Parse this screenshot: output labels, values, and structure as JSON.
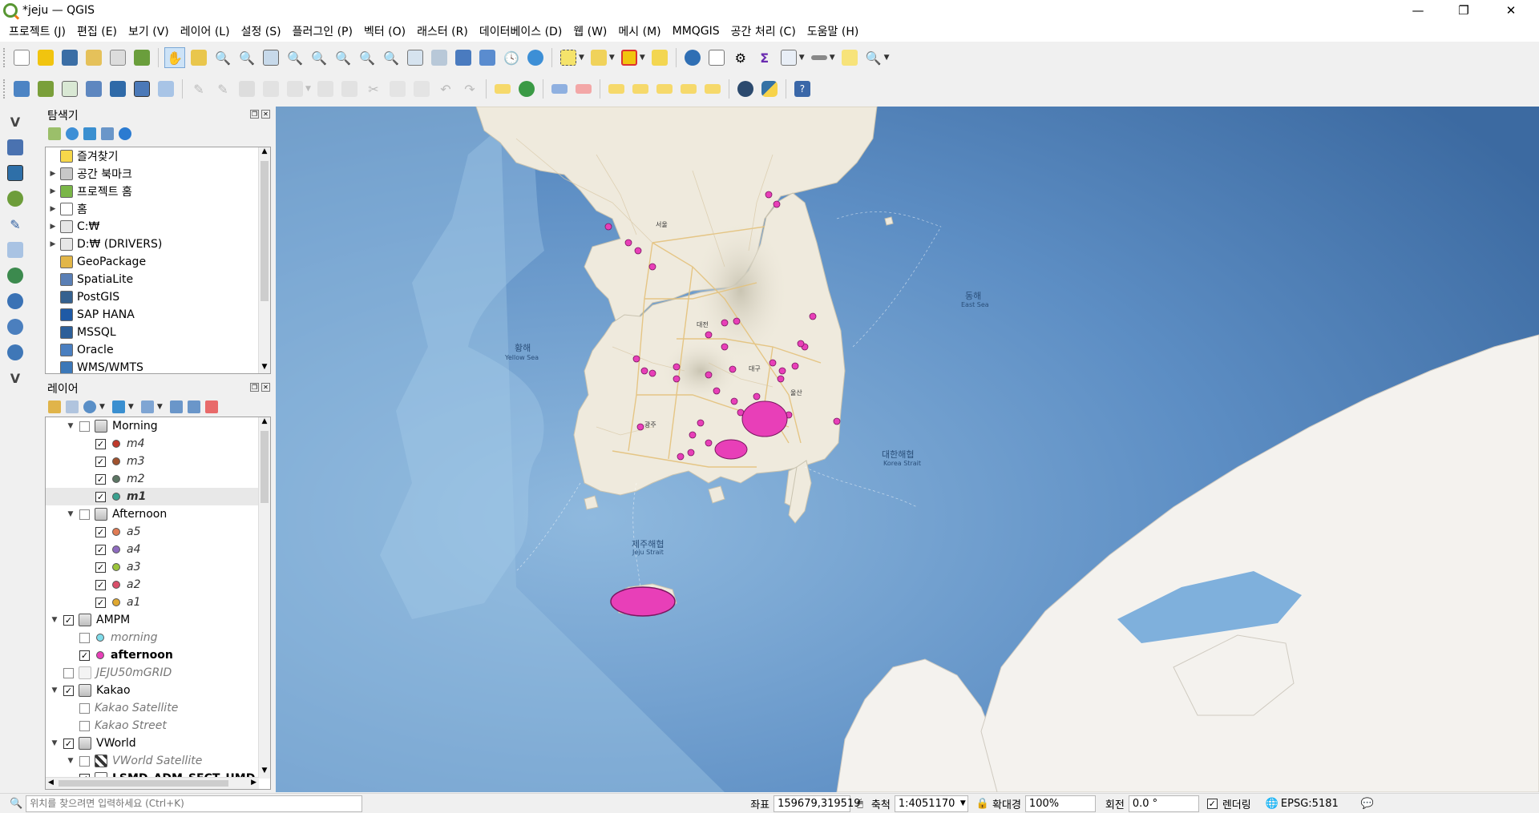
{
  "window": {
    "title": "*jeju — QGIS",
    "minimize": "—",
    "restore": "❐",
    "close": "✕"
  },
  "menu": [
    "프로젝트 (J)",
    "편집 (E)",
    "보기 (V)",
    "레이어 (L)",
    "설정 (S)",
    "플러그인 (P)",
    "벡터 (O)",
    "래스터 (R)",
    "데이터베이스 (D)",
    "웹 (W)",
    "메시 (M)",
    "MMQGIS",
    "공간 처리 (C)",
    "도움말 (H)"
  ],
  "browser": {
    "title": "탐색기",
    "items": [
      {
        "label": "즐겨찾기",
        "icon": "star-icon",
        "expand": false
      },
      {
        "label": "공간 북마크",
        "icon": "bookmark-icon",
        "expand": true
      },
      {
        "label": "프로젝트 홈",
        "icon": "project-home-icon",
        "expand": true
      },
      {
        "label": "홈",
        "icon": "home-icon",
        "expand": true
      },
      {
        "label": "C:₩",
        "icon": "drive-icon",
        "expand": true
      },
      {
        "label": "D:₩ (DRIVERS)",
        "icon": "drive-icon",
        "expand": true
      },
      {
        "label": "GeoPackage",
        "icon": "geopackage-icon",
        "expand": false
      },
      {
        "label": "SpatiaLite",
        "icon": "spatialite-icon",
        "expand": false
      },
      {
        "label": "PostGIS",
        "icon": "postgis-icon",
        "expand": false
      },
      {
        "label": "SAP HANA",
        "icon": "sap-hana-icon",
        "expand": false
      },
      {
        "label": "MSSQL",
        "icon": "mssql-icon",
        "expand": false
      },
      {
        "label": "Oracle",
        "icon": "oracle-icon",
        "expand": false
      },
      {
        "label": "WMS/WMTS",
        "icon": "wms-icon",
        "expand": false
      }
    ]
  },
  "layers": {
    "title": "레이어",
    "items": [
      {
        "label": "Morning",
        "indent": 1,
        "arrow": "▼",
        "checked": false,
        "kind": "group",
        "style": ""
      },
      {
        "label": "m4",
        "indent": 2,
        "checked": true,
        "kind": "dot",
        "color": "#c0392b",
        "style": "it"
      },
      {
        "label": "m3",
        "indent": 2,
        "checked": true,
        "kind": "dot",
        "color": "#a0522d",
        "style": "it"
      },
      {
        "label": "m2",
        "indent": 2,
        "checked": true,
        "kind": "dot",
        "color": "#5b7563",
        "style": "it"
      },
      {
        "label": "m1",
        "indent": 2,
        "checked": true,
        "kind": "dot",
        "color": "#3aa18f",
        "style": "it bd"
      },
      {
        "label": "Afternoon",
        "indent": 1,
        "arrow": "▼",
        "checked": false,
        "kind": "group",
        "style": ""
      },
      {
        "label": "a5",
        "indent": 2,
        "checked": true,
        "kind": "dot",
        "color": "#e07b54",
        "style": "it"
      },
      {
        "label": "a4",
        "indent": 2,
        "checked": true,
        "kind": "dot",
        "color": "#8e6bbf",
        "style": "it"
      },
      {
        "label": "a3",
        "indent": 2,
        "checked": true,
        "kind": "dot",
        "color": "#9bc43b",
        "style": "it"
      },
      {
        "label": "a2",
        "indent": 2,
        "checked": true,
        "kind": "dot",
        "color": "#d94f6a",
        "style": "it"
      },
      {
        "label": "a1",
        "indent": 2,
        "checked": true,
        "kind": "dot",
        "color": "#e0a830",
        "style": "it"
      },
      {
        "label": "AMPM",
        "indent": 0,
        "arrow": "▼",
        "checked": true,
        "kind": "group",
        "style": ""
      },
      {
        "label": "morning",
        "indent": 1,
        "checked": false,
        "kind": "dot",
        "color": "#7fdcea",
        "style": "gr"
      },
      {
        "label": "afternoon",
        "indent": 1,
        "checked": true,
        "kind": "dot",
        "color": "#e83fb8",
        "style": "bd"
      },
      {
        "label": "JEJU50mGRID",
        "indent": 0,
        "checked": false,
        "kind": "grid",
        "style": "gr"
      },
      {
        "label": "Kakao",
        "indent": 0,
        "arrow": "▼",
        "checked": true,
        "kind": "group",
        "style": ""
      },
      {
        "label": "Kakao Satellite",
        "indent": 1,
        "checked": false,
        "kind": "none",
        "style": "gr"
      },
      {
        "label": "Kakao Street",
        "indent": 1,
        "checked": false,
        "kind": "none",
        "style": "gr"
      },
      {
        "label": "VWorld",
        "indent": 0,
        "arrow": "▼",
        "checked": true,
        "kind": "group",
        "style": ""
      },
      {
        "label": "VWorld Satellite",
        "indent": 1,
        "arrow": "▼",
        "checked": false,
        "kind": "raster",
        "style": "gr"
      },
      {
        "label": "LSMD_ADM_SECT_UMD",
        "indent": 1,
        "checked": true,
        "kind": "poly",
        "style": "bd"
      }
    ]
  },
  "map_labels": {
    "yellow_sea": "황해",
    "yellow_sea_en": "Yellow Sea",
    "east_sea": "동해",
    "east_sea_en": "East Sea",
    "korea_strait": "대한해협",
    "korea_strait_en": "Korea Strait",
    "jeju_strait": "제주해협",
    "jeju_strait_en": "Jeju Strait",
    "seoul": "서울",
    "daegu": "대구",
    "busan": "부산",
    "gwangju": "광주",
    "daejeon": "대전",
    "ulsan": "울산"
  },
  "colors": {
    "sea": "#6f9fcb",
    "sea_deep": "#3f6fa5",
    "land": "#efeadd",
    "japan": "#f4f2ee",
    "point": "#e83fb8",
    "point_stroke": "#7a1660"
  },
  "statusbar": {
    "search_placeholder": "위치를 찾으려면 입력하세요 (Ctrl+K)",
    "coord_label": "좌표",
    "coord_value": "159679,319519",
    "scale_label": "축척",
    "scale_value": "1:4051170",
    "magnifier_label": "확대경",
    "magnifier_value": "100%",
    "rotation_label": "회전",
    "rotation_value": "0.0 °",
    "render_label": "렌더링",
    "crs": "EPSG:5181"
  }
}
